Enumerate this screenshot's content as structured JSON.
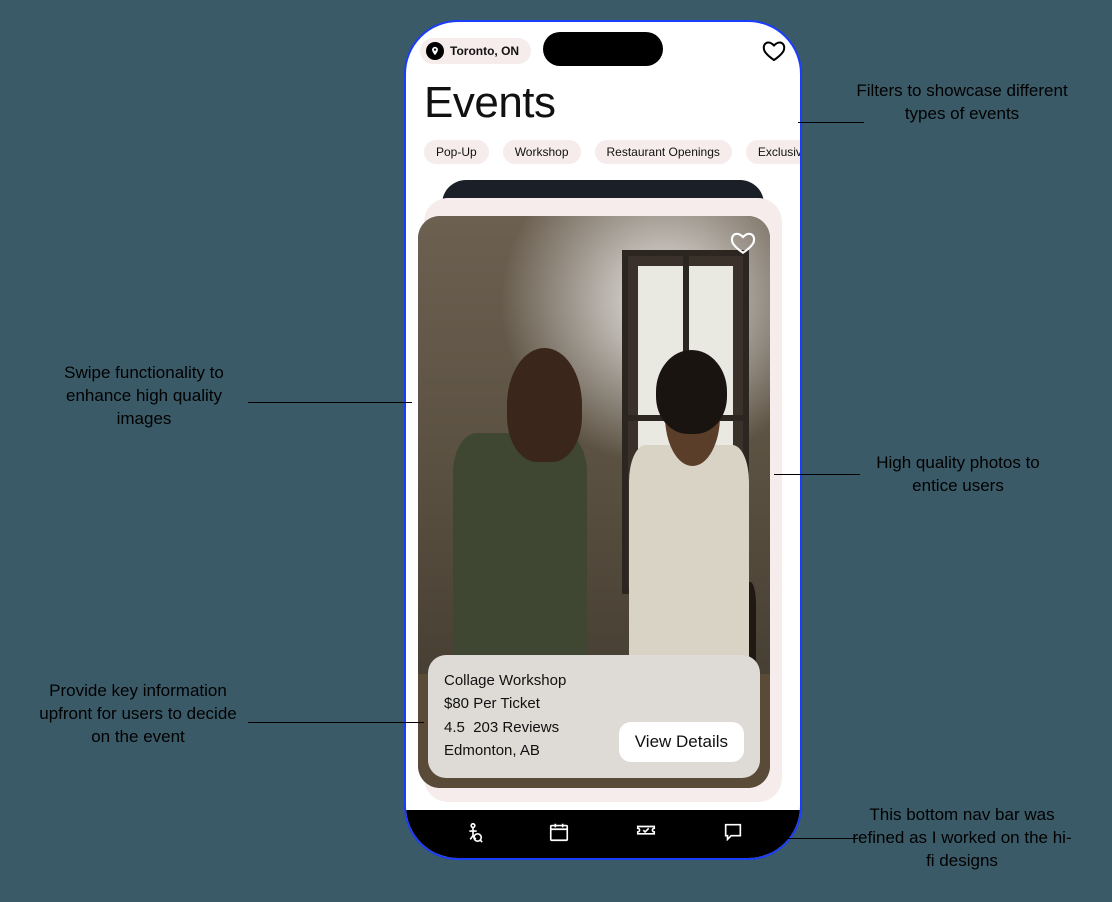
{
  "header": {
    "location": "Toronto, ON",
    "title": "Events"
  },
  "filters": [
    "Pop-Up",
    "Workshop",
    "Restaurant Openings",
    "Exclusive S"
  ],
  "card": {
    "title": "Collage Workshop",
    "price": "$80 Per Ticket",
    "rating": "4.5",
    "reviews": "203 Reviews",
    "location": "Edmonton, AB",
    "cta": "View Details"
  },
  "annotations": {
    "filters": "Filters to showcase different types of events",
    "swipe": "Swipe functionality to enhance high quality images",
    "photos": "High quality photos to entice users",
    "info": "Provide key information upfront for users to decide on the event",
    "nav": "This bottom nav bar was refined as I worked on the hi-fi designs"
  }
}
